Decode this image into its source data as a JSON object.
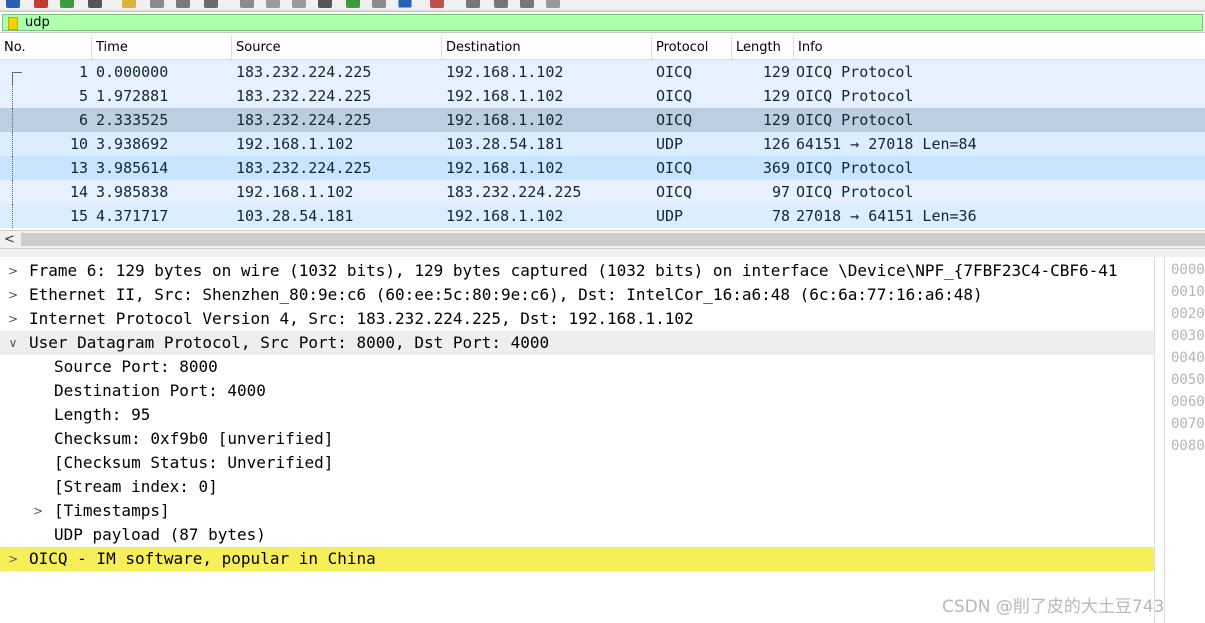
{
  "filter": {
    "value": "udp"
  },
  "colors": {
    "filter_bg": "#afffaf",
    "row_oicq": "#e7f0ff",
    "row_udp": "#daeeff",
    "row_selected": "#bccfe0",
    "detail_highlight": "#f7ef5a"
  },
  "packet_list": {
    "columns": [
      "No.",
      "Time",
      "Source",
      "Destination",
      "Protocol",
      "Length",
      "Info"
    ],
    "rows": [
      {
        "no": "1",
        "time": "0.000000",
        "source": "183.232.224.225",
        "destination": "192.168.1.102",
        "protocol": "OICQ",
        "length": "129",
        "info": "OICQ Protocol"
      },
      {
        "no": "5",
        "time": "1.972881",
        "source": "183.232.224.225",
        "destination": "192.168.1.102",
        "protocol": "OICQ",
        "length": "129",
        "info": "OICQ Protocol"
      },
      {
        "no": "6",
        "time": "2.333525",
        "source": "183.232.224.225",
        "destination": "192.168.1.102",
        "protocol": "OICQ",
        "length": "129",
        "info": "OICQ Protocol"
      },
      {
        "no": "10",
        "time": "3.938692",
        "source": "192.168.1.102",
        "destination": "103.28.54.181",
        "protocol": "UDP",
        "length": "126",
        "info": "64151 → 27018 Len=84"
      },
      {
        "no": "13",
        "time": "3.985614",
        "source": "183.232.224.225",
        "destination": "192.168.1.102",
        "protocol": "OICQ",
        "length": "369",
        "info": "OICQ Protocol"
      },
      {
        "no": "14",
        "time": "3.985838",
        "source": "192.168.1.102",
        "destination": "183.232.224.225",
        "protocol": "OICQ",
        "length": "97",
        "info": "OICQ Protocol"
      },
      {
        "no": "15",
        "time": "4.371717",
        "source": "103.28.54.181",
        "destination": "192.168.1.102",
        "protocol": "UDP",
        "length": "78",
        "info": "27018 → 64151 Len=36"
      }
    ]
  },
  "scrollbar": {
    "left_arrow": "<"
  },
  "details": {
    "rows": [
      {
        "text": "Frame 6: 129 bytes on wire (1032 bits), 129 bytes captured (1032 bits) on interface \\Device\\NPF_{7FBF23C4-CBF6-41",
        "arrow": ">"
      },
      {
        "text": "Ethernet II, Src: Shenzhen_80:9e:c6 (60:ee:5c:80:9e:c6), Dst: IntelCor_16:a6:48 (6c:6a:77:16:a6:48)",
        "arrow": ">"
      },
      {
        "text": "Internet Protocol Version 4, Src: 183.232.224.225, Dst: 192.168.1.102",
        "arrow": ">"
      },
      {
        "text": "User Datagram Protocol, Src Port: 8000, Dst Port: 4000",
        "arrow": "v"
      },
      {
        "text": "Source Port: 8000",
        "arrow": ""
      },
      {
        "text": "Destination Port: 4000",
        "arrow": ""
      },
      {
        "text": "Length: 95",
        "arrow": ""
      },
      {
        "text": "Checksum: 0xf9b0 [unverified]",
        "arrow": ""
      },
      {
        "text": "[Checksum Status: Unverified]",
        "arrow": ""
      },
      {
        "text": "[Stream index: 0]",
        "arrow": ""
      },
      {
        "text": "[Timestamps]",
        "arrow": ">"
      },
      {
        "text": "UDP payload (87 bytes)",
        "arrow": ""
      },
      {
        "text": "OICQ - IM software, popular in China",
        "arrow": ">"
      }
    ]
  },
  "hex": {
    "offsets": [
      "0000",
      "0010",
      "0020",
      "0030",
      "0040",
      "0050",
      "0060",
      "0070",
      "0080"
    ]
  },
  "watermark": "CSDN @削了皮的大土豆743"
}
